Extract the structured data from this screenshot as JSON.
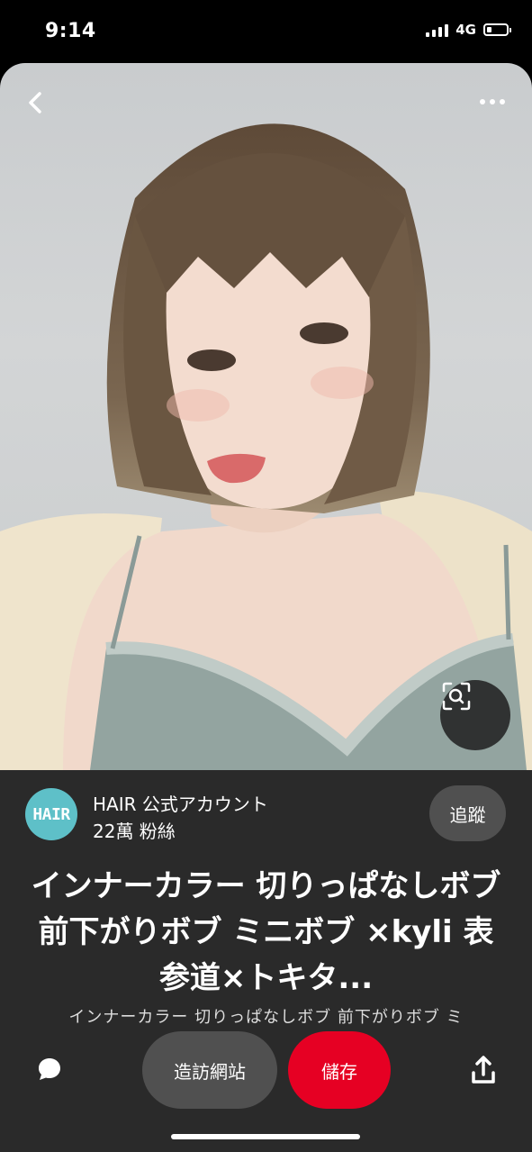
{
  "status_bar": {
    "time": "9:14",
    "network": "4G",
    "battery_level": 0.25
  },
  "photo": {
    "back_icon": "chevron-left-icon",
    "more_icon": "more-horizontal-icon",
    "lens_icon": "visual-search-icon",
    "colors": {
      "background": "#cfd1d2",
      "hair": "#6e5a45",
      "skin": "#f0d6c8",
      "top": "#93a4a0",
      "cardigan": "#efe4cc"
    }
  },
  "account": {
    "avatar_text": "HAIR",
    "name": "HAIR 公式アカウント",
    "followers": "22萬 粉絲",
    "follow_label": "追蹤"
  },
  "pin": {
    "title": "インナーカラー 切りっぱなしボブ 前下がりボブ ミニボブ ×kyli 表参道×トキタ...",
    "description": "インナーカラー 切りっぱなしボブ 前下がりボブ ミ"
  },
  "actions": {
    "comment_icon": "comment-icon",
    "visit_label": "造訪網站",
    "save_label": "儲存",
    "share_icon": "share-icon",
    "accent_color": "#e60023"
  }
}
